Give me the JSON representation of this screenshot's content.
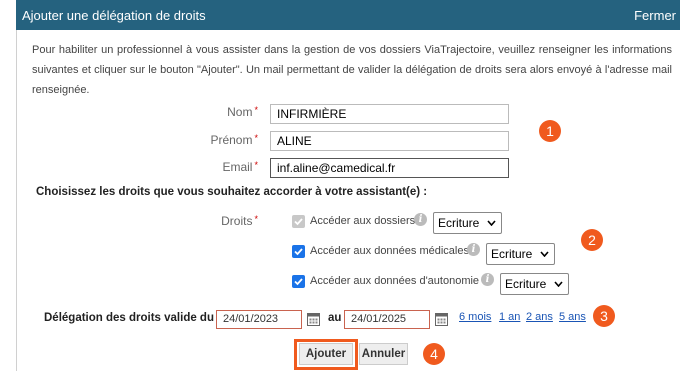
{
  "dialog": {
    "title": "Ajouter une délégation de droits",
    "close_label": "Fermer"
  },
  "intro": "Pour habiliter un professionnel à vous assister dans la gestion de vos dossiers ViaTrajectoire, veuillez renseigner les informations suivantes et cliquer sur le bouton \"Ajouter\". Un mail permettant de valider la délégation de droits sera alors envoyé à l'adresse mail renseignée.",
  "form": {
    "required_mark": "*",
    "nom": {
      "label": "Nom",
      "value": "INFIRMIÈRE"
    },
    "prenom": {
      "label": "Prénom",
      "value": "ALINE"
    },
    "email": {
      "label": "Email",
      "value": "inf.aline@camedical.fr"
    }
  },
  "rights": {
    "heading": "Choisissez les droits que vous souhaitez accorder à votre assistant(e) :",
    "label": "Droits",
    "items": [
      {
        "label": "Accéder aux dossiers",
        "checked": true,
        "disabled": true,
        "access": "Ecriture"
      },
      {
        "label": "Accéder aux données médicales",
        "checked": true,
        "disabled": false,
        "access": "Ecriture"
      },
      {
        "label": "Accéder aux données d'autonomie",
        "checked": true,
        "disabled": false,
        "access": "Ecriture"
      }
    ]
  },
  "validity": {
    "label": "Délégation des droits valide du",
    "from": "24/01/2023",
    "to_label": "au",
    "to": "24/01/2025",
    "shortcuts": [
      "6 mois",
      "1 an",
      "2 ans",
      "5 ans"
    ]
  },
  "buttons": {
    "add": "Ajouter",
    "cancel": "Annuler"
  },
  "steps": [
    "1",
    "2",
    "3",
    "4"
  ],
  "colors": {
    "titlebar": "#25627f",
    "accent": "#f05a1e",
    "checkbox": "#1a73e8",
    "link": "#1a55b5"
  }
}
